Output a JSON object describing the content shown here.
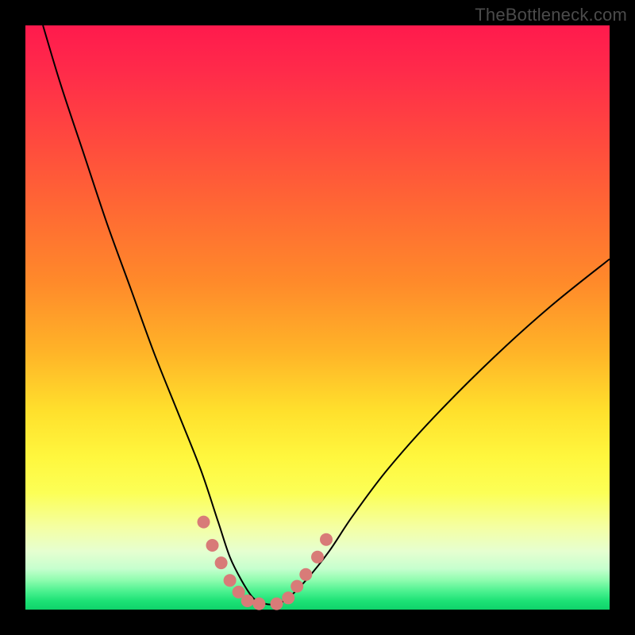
{
  "watermark": "TheBottleneck.com",
  "chart_data": {
    "type": "line",
    "title": "",
    "xlabel": "",
    "ylabel": "",
    "xlim": [
      0,
      100
    ],
    "ylim": [
      0,
      100
    ],
    "grid": false,
    "legend": false,
    "series": [
      {
        "name": "bottleneck-curve",
        "stroke": "#000000",
        "stroke_width": 2,
        "x": [
          3,
          6,
          10,
          14,
          18,
          22,
          26,
          30,
          33,
          35,
          37,
          39,
          41,
          43,
          45,
          48,
          52,
          56,
          62,
          70,
          80,
          90,
          100
        ],
        "y": [
          100,
          90,
          78,
          66,
          55,
          44,
          34,
          24,
          15,
          9,
          5,
          2,
          1,
          1,
          2,
          5,
          10,
          16,
          24,
          33,
          43,
          52,
          60
        ]
      }
    ],
    "highlight_dots": {
      "color": "#d87b78",
      "radius_px": 8,
      "points": [
        {
          "x": 30.5,
          "y": 15
        },
        {
          "x": 32.0,
          "y": 11
        },
        {
          "x": 33.5,
          "y": 8
        },
        {
          "x": 35.0,
          "y": 5
        },
        {
          "x": 36.5,
          "y": 3
        },
        {
          "x": 38.0,
          "y": 1.5
        },
        {
          "x": 40.0,
          "y": 1
        },
        {
          "x": 43.0,
          "y": 1
        },
        {
          "x": 45.0,
          "y": 2
        },
        {
          "x": 46.5,
          "y": 4
        },
        {
          "x": 48.0,
          "y": 6
        },
        {
          "x": 50.0,
          "y": 9
        },
        {
          "x": 51.5,
          "y": 12
        }
      ]
    }
  },
  "colors": {
    "frame": "#000000",
    "watermark": "#4b4b4b",
    "highlight": "#d87b78",
    "gradient_stops": [
      "#ff1a4d",
      "#ff6a33",
      "#ffe02c",
      "#fcff56",
      "#8dfcae",
      "#0fd36b"
    ]
  }
}
